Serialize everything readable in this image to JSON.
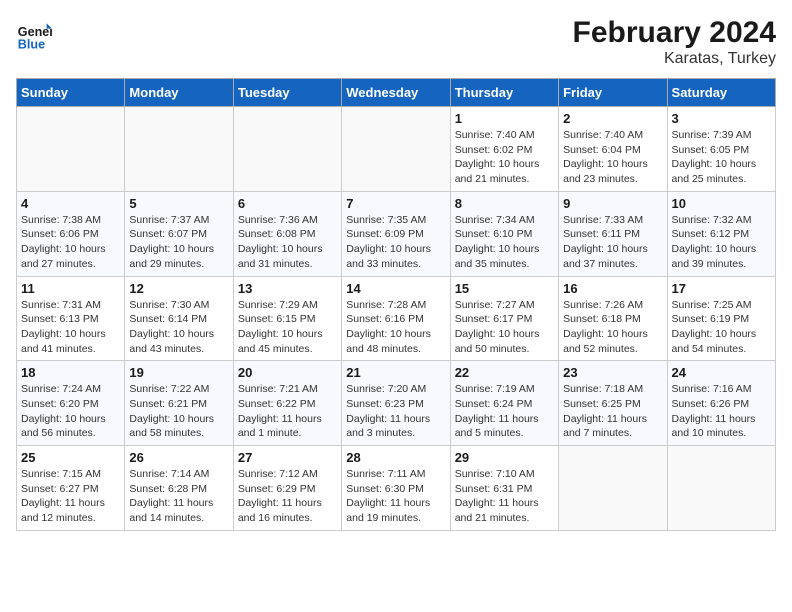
{
  "header": {
    "logo_text_general": "General",
    "logo_text_blue": "Blue",
    "title": "February 2024",
    "subtitle": "Karatas, Turkey"
  },
  "calendar": {
    "weekdays": [
      "Sunday",
      "Monday",
      "Tuesday",
      "Wednesday",
      "Thursday",
      "Friday",
      "Saturday"
    ],
    "weeks": [
      [
        {
          "day": "",
          "empty": true
        },
        {
          "day": "",
          "empty": true
        },
        {
          "day": "",
          "empty": true
        },
        {
          "day": "",
          "empty": true
        },
        {
          "day": "1",
          "sunrise": "7:40 AM",
          "sunset": "6:02 PM",
          "daylight": "10 hours and 21 minutes."
        },
        {
          "day": "2",
          "sunrise": "7:40 AM",
          "sunset": "6:04 PM",
          "daylight": "10 hours and 23 minutes."
        },
        {
          "day": "3",
          "sunrise": "7:39 AM",
          "sunset": "6:05 PM",
          "daylight": "10 hours and 25 minutes."
        }
      ],
      [
        {
          "day": "4",
          "sunrise": "7:38 AM",
          "sunset": "6:06 PM",
          "daylight": "10 hours and 27 minutes."
        },
        {
          "day": "5",
          "sunrise": "7:37 AM",
          "sunset": "6:07 PM",
          "daylight": "10 hours and 29 minutes."
        },
        {
          "day": "6",
          "sunrise": "7:36 AM",
          "sunset": "6:08 PM",
          "daylight": "10 hours and 31 minutes."
        },
        {
          "day": "7",
          "sunrise": "7:35 AM",
          "sunset": "6:09 PM",
          "daylight": "10 hours and 33 minutes."
        },
        {
          "day": "8",
          "sunrise": "7:34 AM",
          "sunset": "6:10 PM",
          "daylight": "10 hours and 35 minutes."
        },
        {
          "day": "9",
          "sunrise": "7:33 AM",
          "sunset": "6:11 PM",
          "daylight": "10 hours and 37 minutes."
        },
        {
          "day": "10",
          "sunrise": "7:32 AM",
          "sunset": "6:12 PM",
          "daylight": "10 hours and 39 minutes."
        }
      ],
      [
        {
          "day": "11",
          "sunrise": "7:31 AM",
          "sunset": "6:13 PM",
          "daylight": "10 hours and 41 minutes."
        },
        {
          "day": "12",
          "sunrise": "7:30 AM",
          "sunset": "6:14 PM",
          "daylight": "10 hours and 43 minutes."
        },
        {
          "day": "13",
          "sunrise": "7:29 AM",
          "sunset": "6:15 PM",
          "daylight": "10 hours and 45 minutes."
        },
        {
          "day": "14",
          "sunrise": "7:28 AM",
          "sunset": "6:16 PM",
          "daylight": "10 hours and 48 minutes."
        },
        {
          "day": "15",
          "sunrise": "7:27 AM",
          "sunset": "6:17 PM",
          "daylight": "10 hours and 50 minutes."
        },
        {
          "day": "16",
          "sunrise": "7:26 AM",
          "sunset": "6:18 PM",
          "daylight": "10 hours and 52 minutes."
        },
        {
          "day": "17",
          "sunrise": "7:25 AM",
          "sunset": "6:19 PM",
          "daylight": "10 hours and 54 minutes."
        }
      ],
      [
        {
          "day": "18",
          "sunrise": "7:24 AM",
          "sunset": "6:20 PM",
          "daylight": "10 hours and 56 minutes."
        },
        {
          "day": "19",
          "sunrise": "7:22 AM",
          "sunset": "6:21 PM",
          "daylight": "10 hours and 58 minutes."
        },
        {
          "day": "20",
          "sunrise": "7:21 AM",
          "sunset": "6:22 PM",
          "daylight": "11 hours and 1 minute."
        },
        {
          "day": "21",
          "sunrise": "7:20 AM",
          "sunset": "6:23 PM",
          "daylight": "11 hours and 3 minutes."
        },
        {
          "day": "22",
          "sunrise": "7:19 AM",
          "sunset": "6:24 PM",
          "daylight": "11 hours and 5 minutes."
        },
        {
          "day": "23",
          "sunrise": "7:18 AM",
          "sunset": "6:25 PM",
          "daylight": "11 hours and 7 minutes."
        },
        {
          "day": "24",
          "sunrise": "7:16 AM",
          "sunset": "6:26 PM",
          "daylight": "11 hours and 10 minutes."
        }
      ],
      [
        {
          "day": "25",
          "sunrise": "7:15 AM",
          "sunset": "6:27 PM",
          "daylight": "11 hours and 12 minutes."
        },
        {
          "day": "26",
          "sunrise": "7:14 AM",
          "sunset": "6:28 PM",
          "daylight": "11 hours and 14 minutes."
        },
        {
          "day": "27",
          "sunrise": "7:12 AM",
          "sunset": "6:29 PM",
          "daylight": "11 hours and 16 minutes."
        },
        {
          "day": "28",
          "sunrise": "7:11 AM",
          "sunset": "6:30 PM",
          "daylight": "11 hours and 19 minutes."
        },
        {
          "day": "29",
          "sunrise": "7:10 AM",
          "sunset": "6:31 PM",
          "daylight": "11 hours and 21 minutes."
        },
        {
          "day": "",
          "empty": true
        },
        {
          "day": "",
          "empty": true
        }
      ]
    ]
  }
}
